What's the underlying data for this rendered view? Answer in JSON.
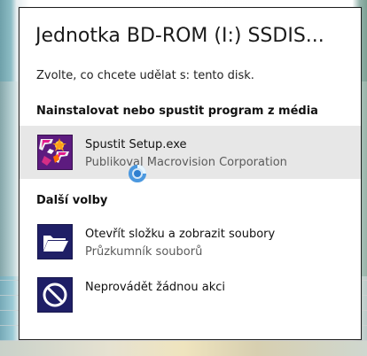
{
  "dialog": {
    "title": "Jednotka BD-ROM (I:) SSDIS...",
    "subtitle": "Zvolte, co chcete udělat s: tento disk.",
    "sections": {
      "install": {
        "label": "Nainstalovat nebo spustit program z média"
      },
      "other": {
        "label": "Další volby"
      }
    },
    "options": {
      "setup": {
        "title": "Spustit Setup.exe",
        "subtitle": "Publikoval Macrovision Corporation",
        "icon": "setup-installer-icon",
        "selected": true
      },
      "open_folder": {
        "title": "Otevřít složku a zobrazit soubory",
        "subtitle": "Průzkumník souborů",
        "icon": "folder-open-icon"
      },
      "no_action": {
        "title": "Neprovádět žádnou akci",
        "icon": "prohibited-icon"
      }
    },
    "cursor": {
      "icon": "busy-cursor-icon"
    }
  },
  "colors": {
    "dialog_bg": "#ffffff",
    "selected_row": "#e7e7e7",
    "icon_blue": "#1f1f66",
    "setup_icon_purple": "#5d1b7f",
    "text_primary": "#111111",
    "text_secondary": "#5b5b5b"
  }
}
